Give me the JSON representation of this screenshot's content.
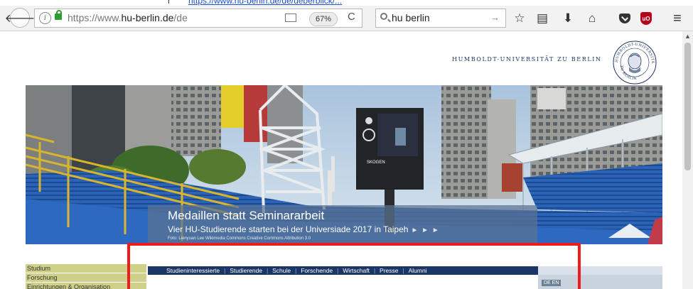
{
  "top_cut": {
    "dot": "r",
    "link": "https://www.hu-berlin.de/de/ueberblick/..."
  },
  "browser": {
    "url_host": "https://www.",
    "url_domain": "hu-berlin.de",
    "url_path": "/de",
    "zoom": "67%",
    "search_value": "hu berlin",
    "icons": [
      "back-arrow-icon",
      "info-icon",
      "lock-icon",
      "reader-view-icon",
      "reload-icon",
      "search-icon",
      "go-arrow-icon",
      "bookmark-star-icon",
      "library-icon",
      "download-icon",
      "home-icon",
      "pocket-icon",
      "ublock-icon",
      "hamburger-menu-icon"
    ],
    "glyphs": {
      "back": "🡐",
      "reload": "C",
      "go": "→",
      "star": "☆",
      "library": "▤",
      "download": "⬇",
      "home": "⌂",
      "menu": "≡",
      "ublock": "uO",
      "info": "i"
    }
  },
  "site": {
    "wordmark": "HUMBOLDT-UNIVERSITÄT ZU BERLIN",
    "seal_text_top": "HUMBOLDT-UNIVERSITÄT",
    "seal_text_bottom": "ZU BERLIN",
    "hero": {
      "headline": "Medaillen statt Seminararbeit",
      "subline": "Vier HU-Studierende starten bei der Universiade 2017 in Taipeh",
      "arrows": "► ► ►",
      "credit": "Foto: Lienyuan Lee Wikimedia Commons Creative Commons Attribution 3.0",
      "scoreboard_brand": "SKOGEN"
    },
    "sidebar": [
      "Studium",
      "Forschung",
      "Einrichtungen & Organisation"
    ],
    "nav": [
      "Studieninteressierte",
      "Studierende",
      "Schule",
      "Forschende",
      "Wirtschaft",
      "Presse",
      "Alumni"
    ],
    "nav_separator": "|",
    "lang": "DE  EN"
  },
  "colors": {
    "hu_blue": "#1b3564",
    "sidebar_olive": "#cfd18a",
    "highlight_red": "#ee1c1c",
    "lock_green": "#2e9c2e"
  }
}
